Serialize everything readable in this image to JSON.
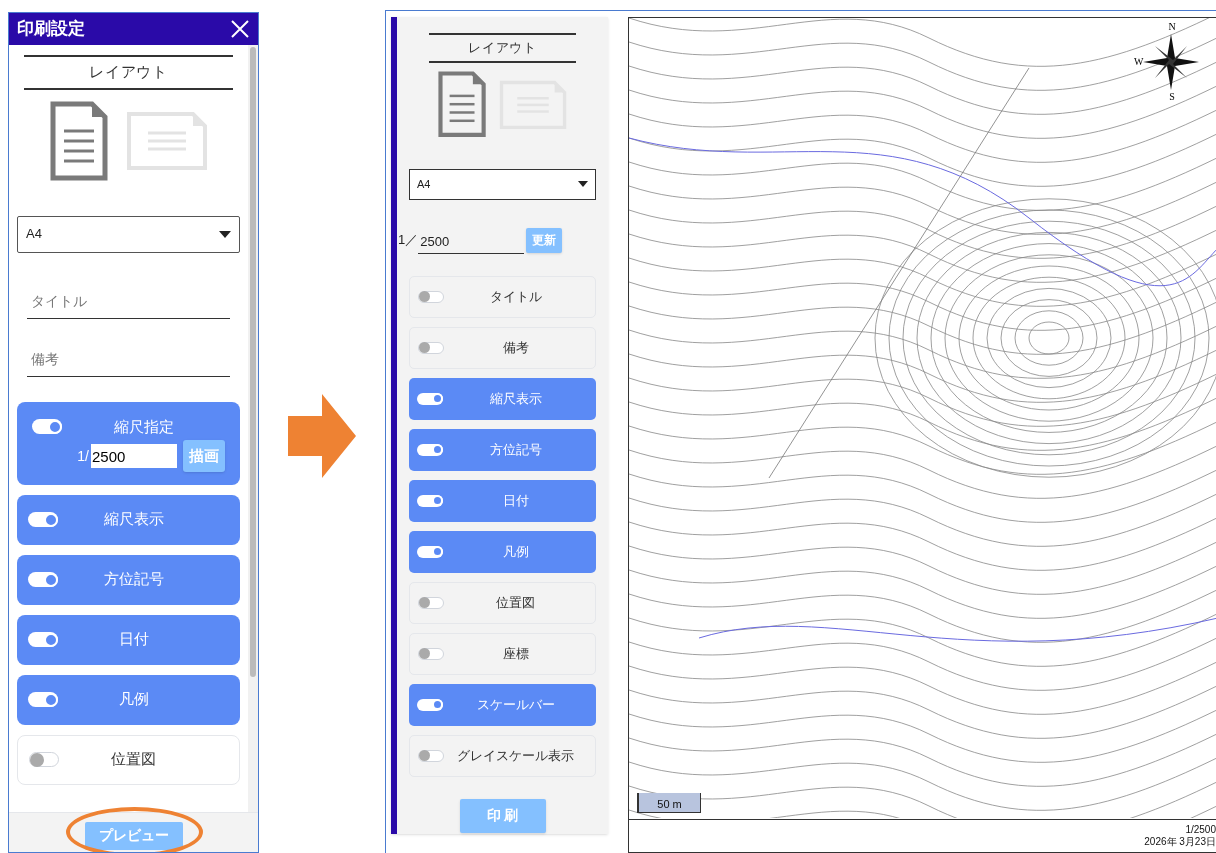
{
  "left_dialog": {
    "title": "印刷設定",
    "layout_heading": "レイアウト",
    "orientations": [
      {
        "kind": "portrait",
        "selected": true
      },
      {
        "kind": "landscape",
        "selected": false
      }
    ],
    "paper_size": "A4",
    "fields": [
      {
        "placeholder": "タイトル"
      },
      {
        "placeholder": "備考"
      }
    ],
    "scale_setting": {
      "label": "縮尺指定",
      "on": true,
      "prefix": "1/",
      "value": "2500",
      "button": "描画"
    },
    "toggles": [
      {
        "label": "縮尺表示",
        "on": true
      },
      {
        "label": "方位記号",
        "on": true
      },
      {
        "label": "日付",
        "on": true
      },
      {
        "label": "凡例",
        "on": true
      },
      {
        "label": "位置図",
        "on": false
      }
    ],
    "preview_button": "プレビュー"
  },
  "right_panel": {
    "layout_heading": "レイアウト",
    "orientations": [
      {
        "kind": "portrait",
        "selected": true
      },
      {
        "kind": "landscape",
        "selected": false
      }
    ],
    "paper_size": "A4",
    "scale": {
      "prefix": "1／",
      "value": "2500",
      "button": "更新"
    },
    "toggles": [
      {
        "label": "タイトル",
        "on": false
      },
      {
        "label": "備考",
        "on": false
      },
      {
        "label": "縮尺表示",
        "on": true
      },
      {
        "label": "方位記号",
        "on": true
      },
      {
        "label": "日付",
        "on": true
      },
      {
        "label": "凡例",
        "on": true
      },
      {
        "label": "位置図",
        "on": false
      },
      {
        "label": "座標",
        "on": false
      },
      {
        "label": "スケールバー",
        "on": true
      },
      {
        "label": "グレイスケール表示",
        "on": false
      }
    ],
    "print_button": "印 刷"
  },
  "map": {
    "compass": {
      "north": "N",
      "west": "W",
      "south": "S"
    },
    "scale_bar": "50 m",
    "footer": [
      "1/2500",
      "2026年 3月23日"
    ]
  }
}
